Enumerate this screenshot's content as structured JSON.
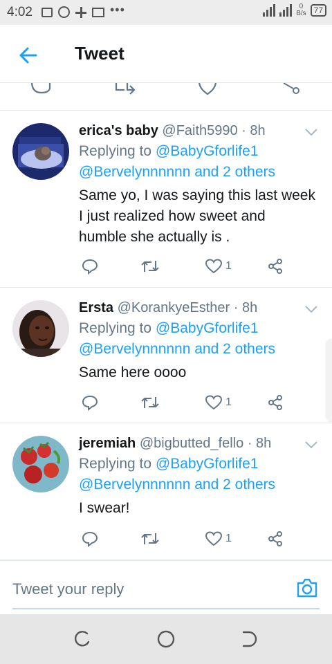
{
  "status_bar": {
    "time": "4:02",
    "more_dots": "•••",
    "net_speed_value": "0",
    "net_speed_unit": "B/s",
    "battery": "77"
  },
  "header": {
    "title": "Tweet"
  },
  "replies": [
    {
      "name": "erica's baby",
      "handle": "@Faith5990",
      "time": "· 8h",
      "replying_prefix": "Replying to",
      "replying_to_1": "@BabyGforlife1",
      "replying_to_2": "@Bervelynnnnnn and 2 others",
      "text_lines": [
        "Same yo, I was saying this last week",
        "I just realized how sweet and",
        "humble she actually is ."
      ],
      "likes": "1"
    },
    {
      "name": "Ersta",
      "handle": "@KorankyeEsther",
      "time": "· 8h",
      "replying_prefix": "Replying to",
      "replying_to_1": "@BabyGforlife1",
      "replying_to_2": "@Bervelynnnnnn and 2 others",
      "text_lines": [
        "Same here oooo"
      ],
      "likes": "1"
    },
    {
      "name": "jeremiah",
      "handle": "@bigbutted_fello",
      "time": "· 8h",
      "replying_prefix": "Replying to",
      "replying_to_1": "@BabyGforlife1",
      "replying_to_2": "@Bervelynnnnnn and 2 others",
      "text_lines": [
        "I swear!"
      ],
      "likes": "1"
    }
  ],
  "reply_bar": {
    "placeholder": "Tweet your reply"
  },
  "colors": {
    "accent": "#1da1f2",
    "secondary_text": "#657786",
    "primary_text": "#14171a",
    "divider": "#e1e8ed"
  },
  "icons": [
    "back-arrow-icon",
    "reply-icon",
    "retweet-icon",
    "like-icon",
    "share-icon",
    "chevron-down-icon",
    "camera-icon",
    "recents-nav-icon",
    "home-nav-icon",
    "back-nav-icon"
  ]
}
